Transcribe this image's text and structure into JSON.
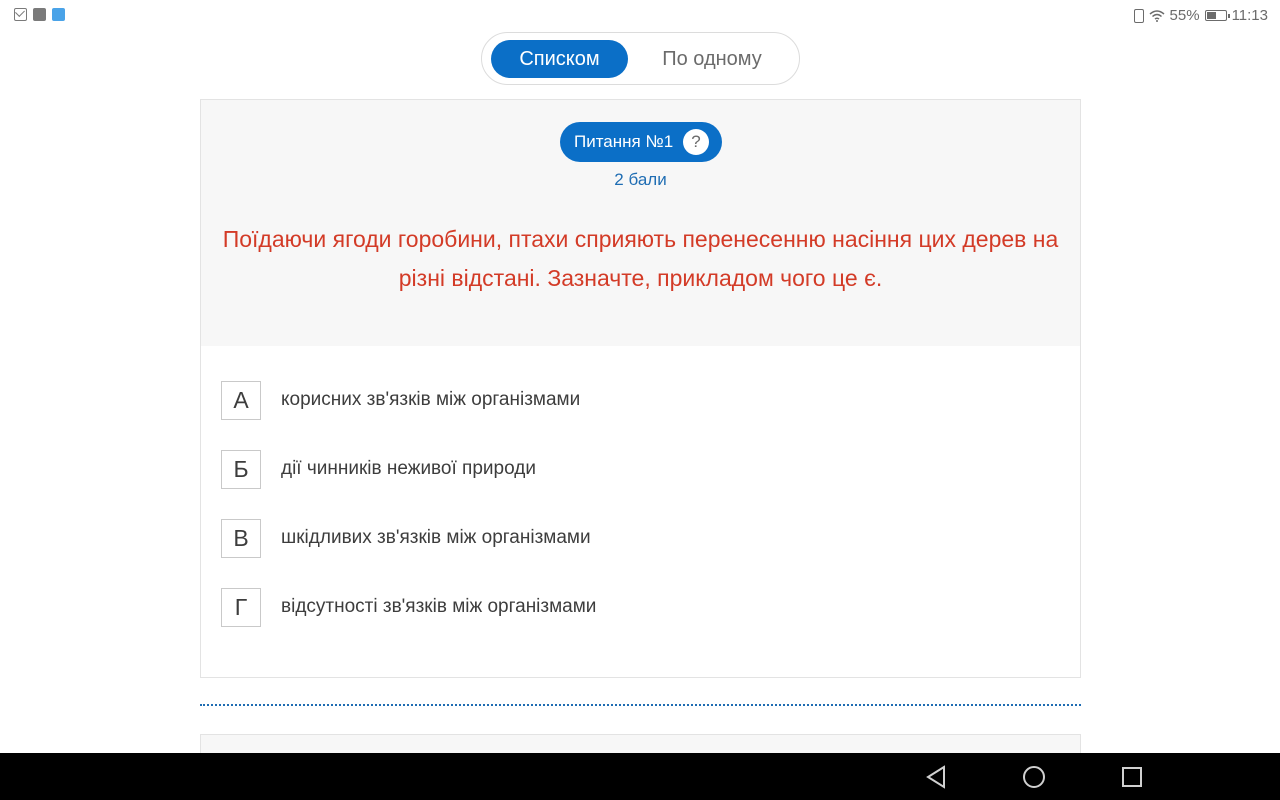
{
  "status_bar": {
    "battery_percent": "55%",
    "battery_level": 0.55,
    "time": "11:13",
    "icons": [
      "mail-icon",
      "app-icon",
      "app-blue-icon",
      "vibrate-icon",
      "wifi-icon",
      "battery-icon"
    ]
  },
  "view_toggle": {
    "list_label": "Списком",
    "single_label": "По одному",
    "active": "list"
  },
  "question": {
    "badge_label": "Питання №1",
    "help_label": "?",
    "points": "2 бали",
    "text": "Поїдаючи ягоди горобини, птахи сприяють перенесенню насіння цих дерев на різні відстані. Зазначте, прикладом чого це є.",
    "answers": [
      {
        "letter": "А",
        "text": "корисних зв'язків між організмами"
      },
      {
        "letter": "Б",
        "text": "дії чинників неживої природи"
      },
      {
        "letter": "В",
        "text": "шкідливих зв'язків між організмами"
      },
      {
        "letter": "Г",
        "text": "відсутності зв'язків між організмами"
      }
    ]
  },
  "colors": {
    "accent": "#0b6fc7",
    "question_text": "#d33b27",
    "points_text": "#1f6db3"
  },
  "nav_bar": {
    "icons": [
      "back-icon",
      "home-icon",
      "recents-icon"
    ]
  }
}
